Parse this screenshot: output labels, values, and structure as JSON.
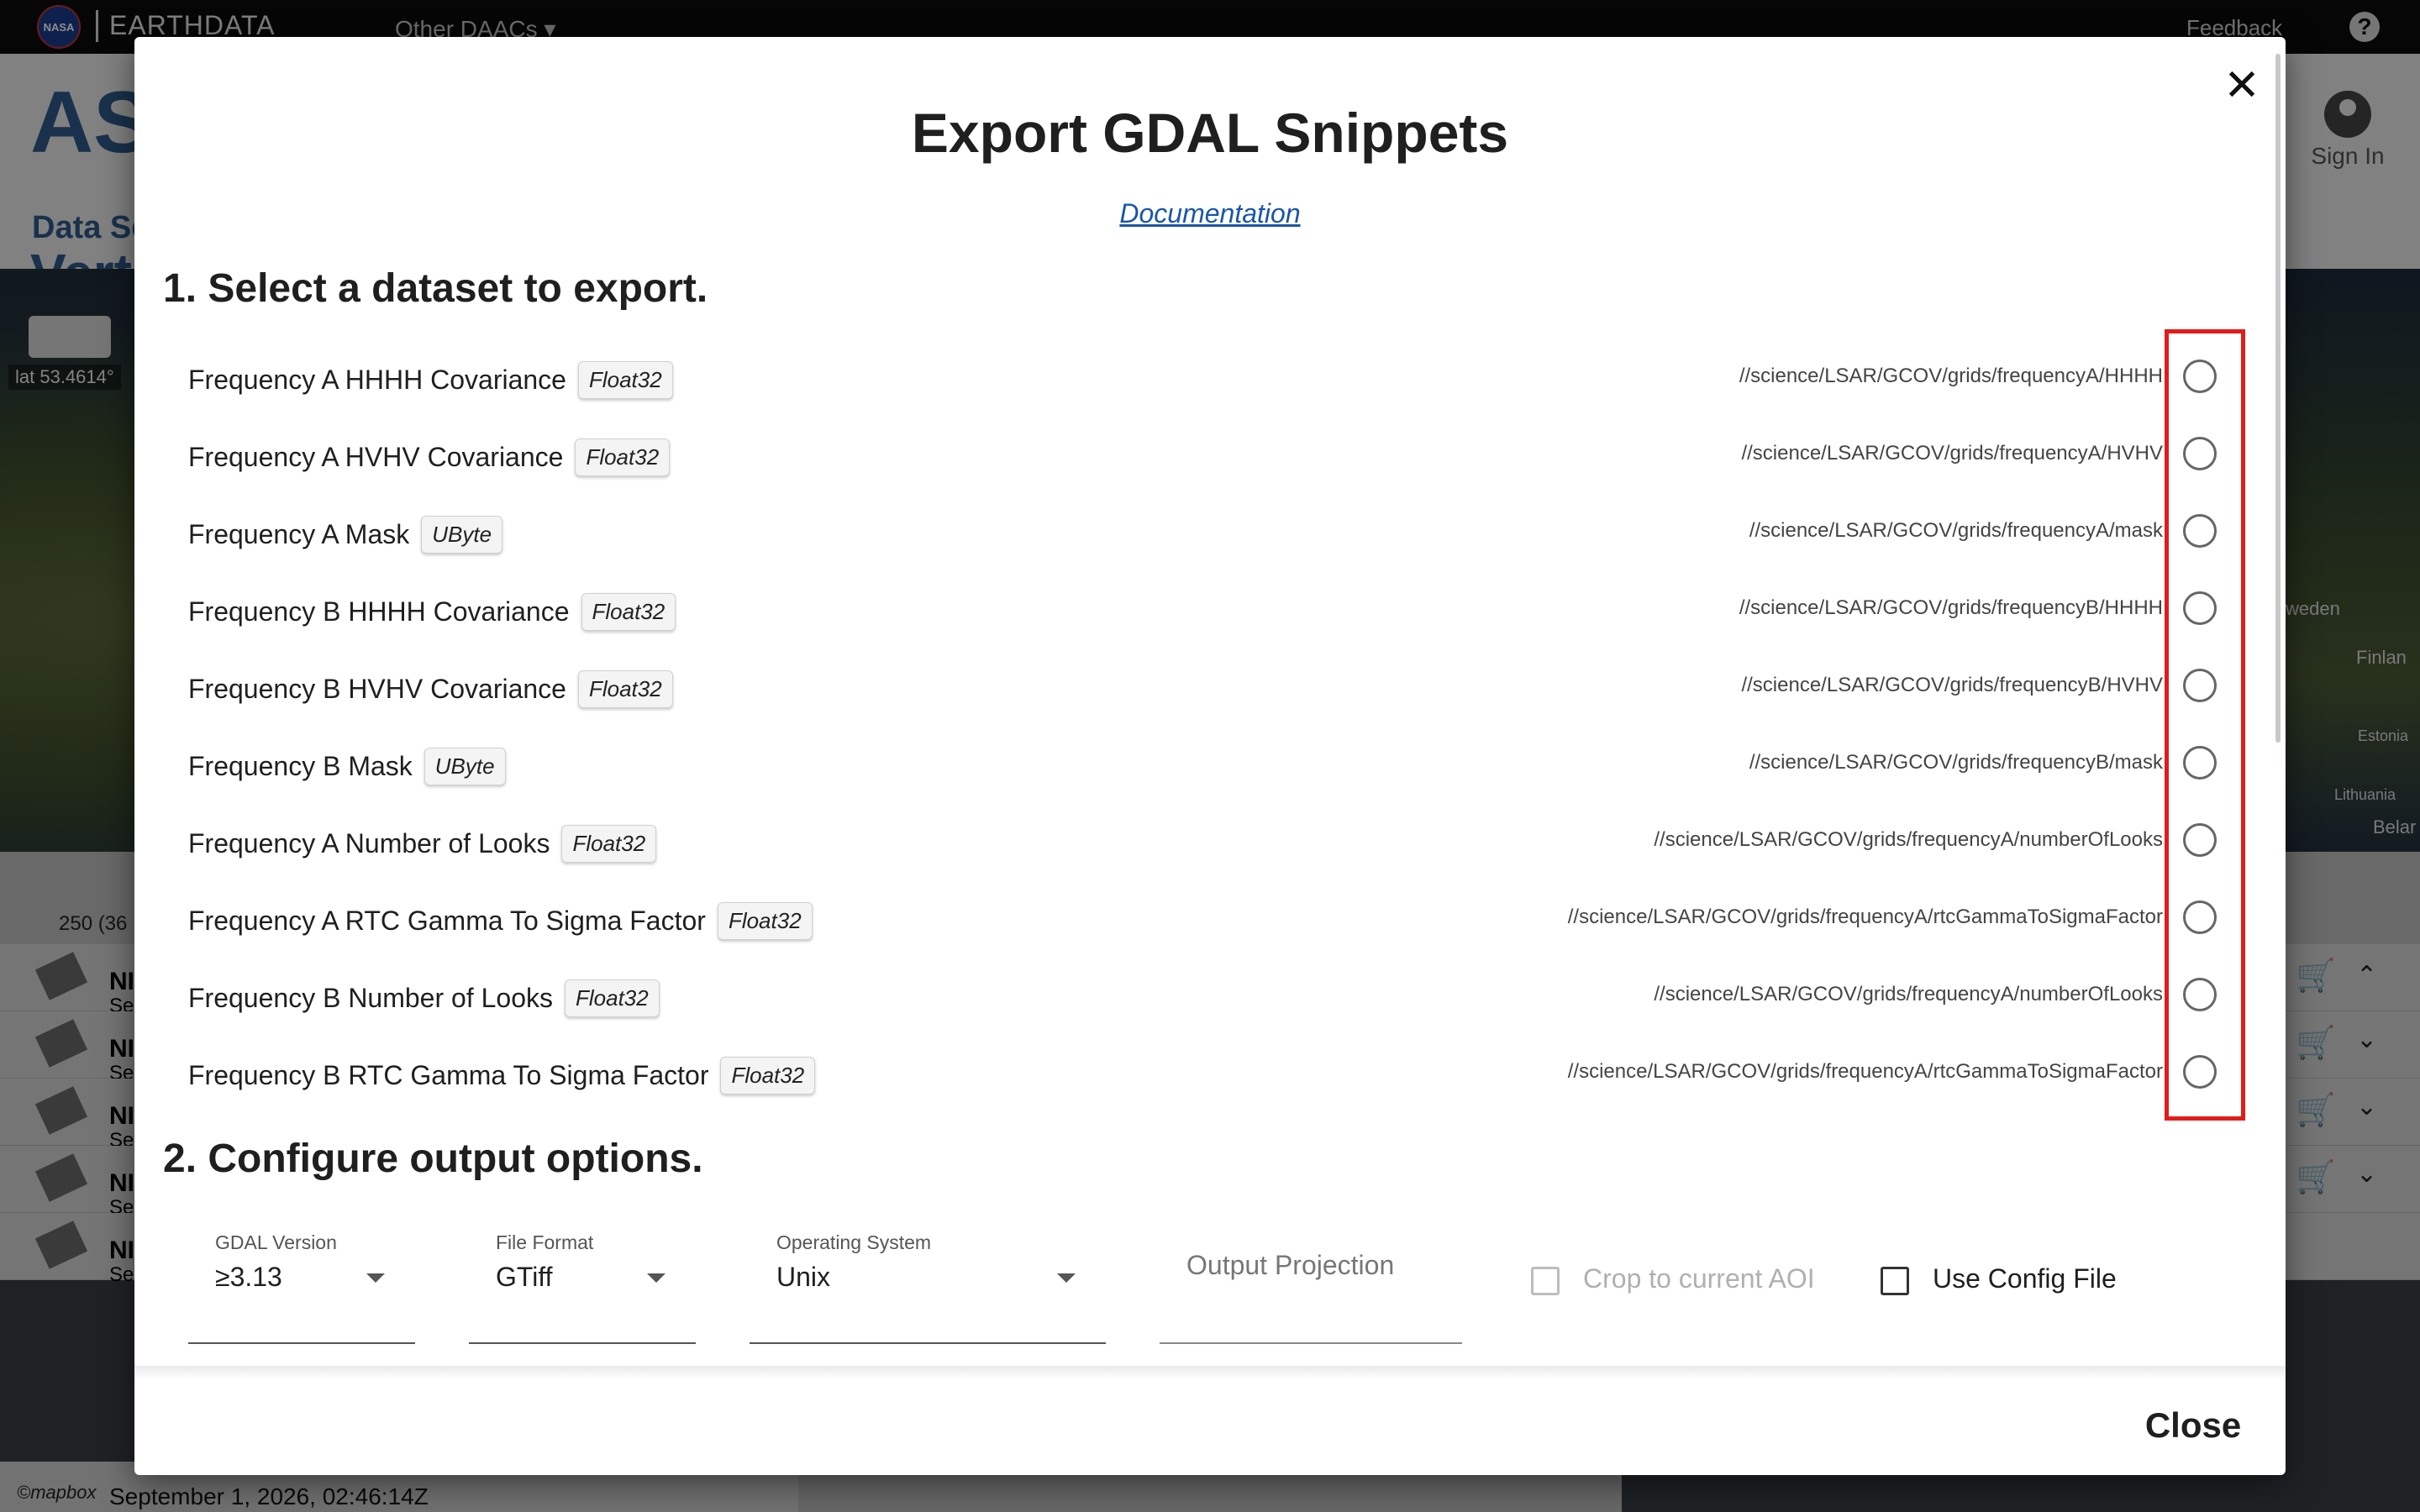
{
  "app": {
    "nasa_logo": "NASA",
    "brand": "EARTHDATA",
    "daacs_menu": "Other DAACs ▾",
    "feedback": "Feedback",
    "help": "?",
    "logo_text": "AS",
    "logo_sub": "Data Se",
    "logo_vert": "Vert",
    "sign_in": "Sign In",
    "lat": "lat 53.4614°",
    "results_count": "250 (36",
    "bottom_date": "September 1, 2026, 02:46:14Z",
    "mapbox": "©mapbox",
    "map_labels": [
      "weden",
      "Finlan",
      "Estonia",
      "Lithuania",
      "Belar"
    ],
    "result_rows": [
      {
        "prefix": "NI",
        "sub": "Se"
      },
      {
        "prefix": "NI",
        "sub": "Se"
      },
      {
        "prefix": "NI",
        "sub": "Se"
      },
      {
        "prefix": "NI",
        "sub": "Se"
      },
      {
        "prefix": "NI",
        "sub": "Se"
      }
    ]
  },
  "modal": {
    "title": "Export GDAL Snippets",
    "documentation_link": "Documentation",
    "section1_title": "1. Select a dataset to export.",
    "section2_title": "2. Configure output options.",
    "close_button": "Close",
    "datasets": [
      {
        "name": "Frequency A HHHH Covariance",
        "type": "Float32",
        "path": "//science/LSAR/GCOV/grids/frequencyA/HHHH"
      },
      {
        "name": "Frequency A HVHV Covariance",
        "type": "Float32",
        "path": "//science/LSAR/GCOV/grids/frequencyA/HVHV"
      },
      {
        "name": "Frequency A Mask",
        "type": "UByte",
        "path": "//science/LSAR/GCOV/grids/frequencyA/mask"
      },
      {
        "name": "Frequency B HHHH Covariance",
        "type": "Float32",
        "path": "//science/LSAR/GCOV/grids/frequencyB/HHHH"
      },
      {
        "name": "Frequency B HVHV Covariance",
        "type": "Float32",
        "path": "//science/LSAR/GCOV/grids/frequencyB/HVHV"
      },
      {
        "name": "Frequency B Mask",
        "type": "UByte",
        "path": "//science/LSAR/GCOV/grids/frequencyB/mask"
      },
      {
        "name": "Frequency A Number of Looks",
        "type": "Float32",
        "path": "//science/LSAR/GCOV/grids/frequencyA/numberOfLooks"
      },
      {
        "name": "Frequency A RTC Gamma To Sigma Factor",
        "type": "Float32",
        "path": "//science/LSAR/GCOV/grids/frequencyA/rtcGammaToSigmaFactor"
      },
      {
        "name": "Frequency B Number of Looks",
        "type": "Float32",
        "path": "//science/LSAR/GCOV/grids/frequencyA/numberOfLooks"
      },
      {
        "name": "Frequency B RTC Gamma To Sigma Factor",
        "type": "Float32",
        "path": "//science/LSAR/GCOV/grids/frequencyA/rtcGammaToSigmaFactor"
      }
    ],
    "options": {
      "gdal_version": {
        "label": "GDAL Version",
        "value": "≥3.13"
      },
      "file_format": {
        "label": "File Format",
        "value": "GTiff"
      },
      "operating_system": {
        "label": "Operating System",
        "value": "Unix"
      },
      "output_projection": {
        "placeholder": "Output Projection"
      },
      "crop_to_aoi": {
        "label": "Crop to current AOI",
        "checked": false,
        "disabled": true
      },
      "use_config_file": {
        "label": "Use Config File",
        "checked": false
      }
    }
  },
  "colors": {
    "highlight": "#e21b1b",
    "link": "#1a56a8",
    "topbar": "#0b0b0b"
  },
  "icons": [
    "close-icon",
    "help-icon",
    "user-avatar-icon",
    "cart-icon",
    "chevron-up-icon",
    "chevron-down-icon",
    "dropdown-caret-icon",
    "radio-unchecked-icon",
    "checkbox-unchecked-icon"
  ]
}
